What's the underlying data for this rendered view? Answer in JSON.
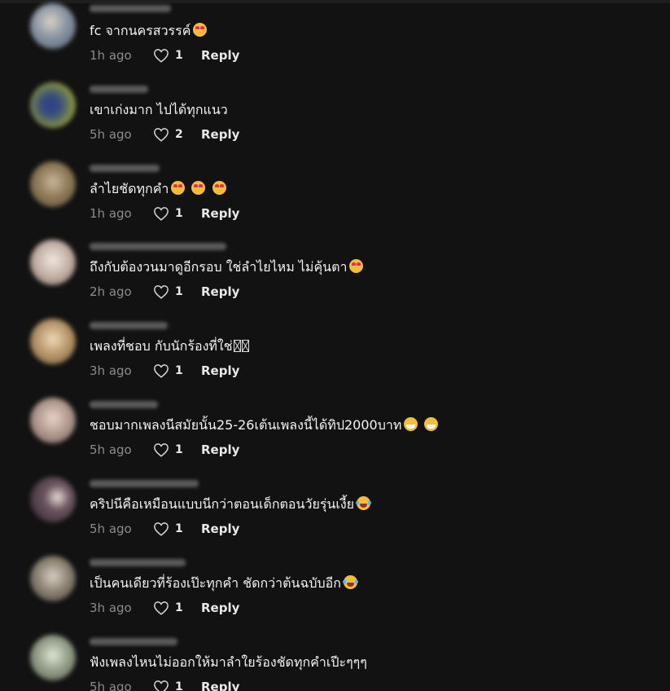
{
  "comments": [
    {
      "text": "fc จากนครสวรรค์",
      "emojis": [
        "smiling-face-with-heart-eyes"
      ],
      "time": "1h ago",
      "likes": "1",
      "reply_label": "Reply",
      "avatar_color": "#6f7f8f"
    },
    {
      "text": "เขาเก่งมาก ไปได้ทุกแนว",
      "emojis": [],
      "time": "5h ago",
      "likes": "2",
      "reply_label": "Reply",
      "avatar_color": "#4e4f3a"
    },
    {
      "text": "ลำไยชัดทุกคำ",
      "emojis": [
        "smiling-face-with-heart-eyes",
        "smiling-face-with-heart-eyes",
        "smiling-face-with-heart-eyes"
      ],
      "time": "1h ago",
      "likes": "1",
      "reply_label": "Reply",
      "avatar_color": "#7d6e55"
    },
    {
      "text": "ถึงกับต้องวนมาดูอีกรอบ ใช่ลำไยไหม ไม่คุ้นตา",
      "emojis": [
        "smiling-face-with-heart-eyes"
      ],
      "time": "2h ago",
      "likes": "1",
      "reply_label": "Reply",
      "avatar_color": "#b9aca5"
    },
    {
      "text": "เพลงที่ชอบ กับนักร้องที่ใช่",
      "emojis": [
        "missing-glyph",
        "missing-glyph"
      ],
      "time": "3h ago",
      "likes": "1",
      "reply_label": "Reply",
      "avatar_color": "#a88a63"
    },
    {
      "text": "ชอบมากเพลงนีสมัยนั้น25-26เต้นเพลงนี้ได้ทิป2000บาท",
      "emojis": [
        "beaming-face",
        "beaming-face"
      ],
      "time": "5h ago",
      "likes": "1",
      "reply_label": "Reply",
      "avatar_color": "#b39a90"
    },
    {
      "text": "คริปนีคือเหมือนแบบนีกว่าตอนเด็กตอนวัยรุ่นเงี้ย",
      "emojis": [
        "face-with-tears-of-joy"
      ],
      "time": "5h ago",
      "likes": "1",
      "reply_label": "Reply",
      "avatar_color": "#4a3c42"
    },
    {
      "text": "เป็นคนเดียวที่ร้องเป๊ะทุกคำ ชัดกว่าต้นฉบับอีก",
      "emojis": [
        "face-with-tears-of-joy"
      ],
      "time": "3h ago",
      "likes": "1",
      "reply_label": "Reply",
      "avatar_color": "#8d8576"
    },
    {
      "text": "ฟังเพลงไหนไม่ออกให้มาลำใยร้องชัดทุกคำเปีะๆๆๆ",
      "emojis": [],
      "time": "5h ago",
      "likes": "1",
      "reply_label": "Reply",
      "avatar_color": "#8f9a86"
    }
  ]
}
